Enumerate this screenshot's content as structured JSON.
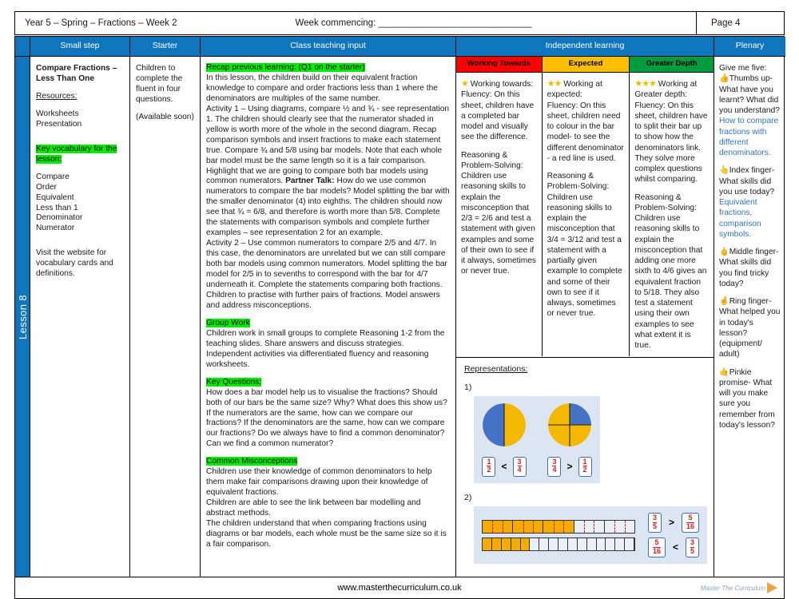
{
  "header": {
    "left": "Year 5 – Spring – Fractions – Week 2",
    "week_commencing": "Week commencing: ______________________________",
    "page": "Page 4"
  },
  "spine": {
    "label": "Lesson 8"
  },
  "columns": {
    "small_step": "Small step",
    "starter": "Starter",
    "class_teaching_input": "Class teaching input",
    "independent_learning": "Independent learning",
    "plenary": "Plenary"
  },
  "small_step": {
    "title": "Compare Fractions – Less Than One",
    "resources_label": "Resources:",
    "resources": [
      "Worksheets",
      "Presentation"
    ],
    "vocab_heading": "Key vocabulary for the lesson:",
    "vocabulary": [
      "Compare",
      "Order",
      "Equivalent",
      "Less than 1",
      "Denominator",
      "Numerator"
    ],
    "footer_note": "Visit the website for vocabulary cards and definitions."
  },
  "starter": {
    "text": "Children to complete the fluent in four questions.",
    "availability": "(Available soon)"
  },
  "class_teaching_input": {
    "recap_heading": "Recap previous learning: (Q1 on the starter)",
    "recap_body_1": "In this lesson, the children build on their equivalent fraction knowledge to compare and order fractions less than 1 where the denominators are multiples of the same number.",
    "recap_body_2": "Activity 1 – Using diagrams, compare ½ and ¾ - see representation 1. The children should clearly see that the numerator shaded in yellow is worth more of the whole in the second diagram. Recap comparison symbols and insert fractions to make each statement true. Compare ¾ and 5/8 using bar models. Note that each whole bar model must be the same length so it is a fair comparison.  Highlight that we are going to compare both bar models using common numerators. ",
    "partner_talk_label": "Partner Talk:",
    "recap_body_3": " How do we use common numerators to compare the bar models? Model splitting the bar with the smaller denominator (4) into eighths. The children should now see that ¾ = 6/8, and therefore is worth more than 5/8. Complete the statements with comparison symbols and complete further examples – see representation 2 for an example.",
    "recap_body_4": "Activity 2 – Use common numerators to compare 2/5 and 4/7. In this case, the denominators are unrelated but we can still compare both bar models using common numerators. Model splitting the bar model for 2/5 in to sevenths to correspond with the bar for 4/7 underneath it. Complete the statements comparing both fractions. Children to practise with further pairs of fractions. Model answers and address misconceptions.",
    "group_work_heading": "Group Work",
    "group_work_body": "Children work in small groups to complete Reasoning 1-2 from the teaching slides. Share answers and discuss strategies. Independent activities via differentiated fluency and reasoning worksheets.",
    "key_questions_heading": "Key Questions:",
    "key_questions_body": "How does a bar model help us to visualise the fractions? Should both of our bars be the same size? Why? What does this show us? If the numerators are the same, how can we compare our fractions? If the denominators are the same, how can we compare our fractions? Do we always have to find a common denominator? Can we find a common numerator?",
    "misconceptions_heading": "Common Misconceptions",
    "misconceptions_body_1": "Children use their knowledge of common denominators to help them make fair comparisons drawing upon their knowledge of equivalent fractions.",
    "misconceptions_body_2": "Children are able to see the link between bar modelling and abstract methods.",
    "misconceptions_body_3": "The children understand that when comparing fractions using diagrams or bar models, each whole must be the same size so it is a fair comparison."
  },
  "independent_learning": {
    "levels": [
      {
        "header": "Working Towards",
        "header_color": "#ff0000",
        "stars": 1,
        "intro": "Working towards:",
        "fluency": "Fluency: On this sheet, children have a completed bar model and visually see the difference.",
        "reasoning": "Reasoning & Problem-Solving: Children use reasoning skills to explain the misconception that 2/3 = 2/6 and test a statement with given examples and some of their own to see if it always, sometimes or never true."
      },
      {
        "header": "Expected",
        "header_color": "#ffbf00",
        "stars": 2,
        "intro": "Working at expected:",
        "fluency": "Fluency: On this sheet, children need to colour in the bar model- to see the different denominator - a red line is used.",
        "reasoning": "Reasoning & Problem-Solving: Children use reasoning skills to explain the misconception that 3/4 = 3/12 and test a statement with  a partially given example to complete and some of their own to see if it always, sometimes or never true."
      },
      {
        "header": "Greater Depth",
        "header_color": "#009c3f",
        "stars": 3,
        "intro": "Working at Greater depth:",
        "fluency": "Fluency: On this sheet, children have to split their bar up to show how the denominators link. They solve more complex questions whilst comparing.",
        "reasoning": "Reasoning & Problem-Solving: Children use reasoning skills to explain the misconception that adding one more sixth to 4/6 gives an equivalent fraction to 5/18. They also test a statement using their own examples to see what extent it is true."
      }
    ]
  },
  "representations": {
    "title": "Representations:",
    "items": [
      {
        "number": "1)",
        "type": "pie-pair",
        "pies": [
          {
            "denominator": 2,
            "shaded": 1,
            "shaded_color": "#f5b800",
            "unshaded_color": "#4472c4"
          },
          {
            "denominator": 4,
            "shaded": 3,
            "shaded_color": "#f5b800",
            "unshaded_color": "#4472c4"
          }
        ],
        "statements": [
          {
            "left_num": "1",
            "left_den": "2",
            "symbol": "<",
            "right_num": "3",
            "right_den": "4"
          },
          {
            "left_num": "3",
            "left_den": "4",
            "symbol": ">",
            "right_num": "1",
            "right_den": "2"
          }
        ]
      },
      {
        "number": "2)",
        "type": "bar-pair",
        "bars": [
          {
            "segments": 5,
            "shaded": 3,
            "subdivisions": 3,
            "label": "3/5"
          },
          {
            "segments": 16,
            "shaded": 5,
            "subdivisions": 1,
            "label": "5/16"
          }
        ],
        "statements": [
          {
            "left_num": "3",
            "left_den": "5",
            "symbol": ">",
            "right_num": "5",
            "right_den": "16"
          },
          {
            "left_num": "5",
            "left_den": "16",
            "symbol": "<",
            "right_num": "3",
            "right_den": "5"
          }
        ]
      }
    ]
  },
  "plenary": {
    "intro": "Give me five:",
    "items": [
      {
        "finger": "Thumbs up-",
        "question": "What have you learnt? What did you understand?",
        "answer": "How to compare fractions with different denominators."
      },
      {
        "finger": "Index finger-",
        "question": "What skills did you use today?",
        "answer": "Equivalent fractions, comparison symbols."
      },
      {
        "finger": "Middle finger-",
        "question": "What skills did you find tricky today?",
        "answer": ""
      },
      {
        "finger": "Ring finger-",
        "question": "What helped you in today's lesson? (equipment/ adult)",
        "answer": ""
      },
      {
        "finger": "Pinkie",
        "question": "promise- What will you make sure you remember from today's lesson?",
        "answer": ""
      }
    ]
  },
  "footer": {
    "url": "www.masterthecurriculum.co.uk",
    "logo_text": "Master  The  Curriculum"
  }
}
